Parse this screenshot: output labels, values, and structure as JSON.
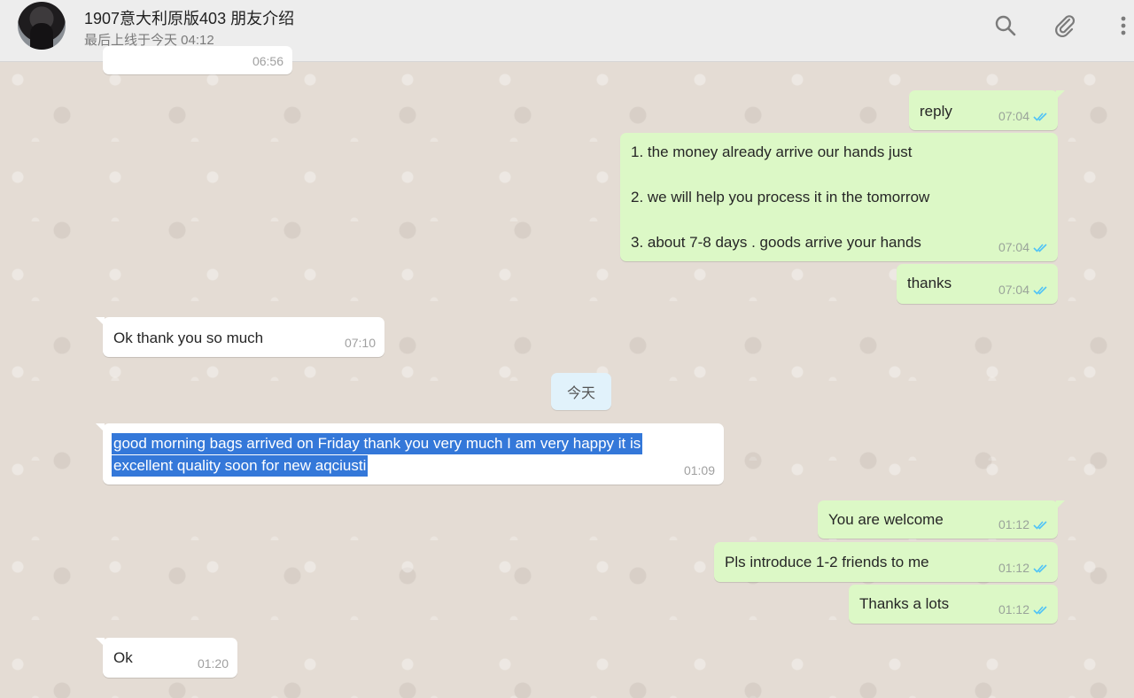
{
  "header": {
    "contact_name": "1907意大利原版403 朋友介绍",
    "contact_status": "最后上线于今天 04:12",
    "icons": [
      "search-icon",
      "attach-icon",
      "menu-icon"
    ]
  },
  "messages": {
    "partial_top": {
      "time": "06:56"
    },
    "m1": {
      "text": "reply",
      "time": "07:04"
    },
    "m2": {
      "line1": "1. the money already arrive our hands just",
      "line2": "2. we will help you process it in the tomorrow",
      "line3": "3. about 7-8 days . goods arrive your hands",
      "time": "07:04"
    },
    "m3": {
      "text": "thanks",
      "time": "07:04"
    },
    "m4": {
      "text": "Ok thank you so much",
      "time": "07:10"
    },
    "date_divider": "今天",
    "m5": {
      "line1": "good morning bags arrived on Friday thank you very much I am very happy it is",
      "line2": "excellent quality soon for new aqciusti",
      "time": "01:09"
    },
    "m6": {
      "text": "You are welcome",
      "time": "01:12"
    },
    "m7": {
      "text": "Pls introduce 1-2 friends to me",
      "time": "01:12"
    },
    "m8": {
      "text": "Thanks a lots",
      "time": "01:12"
    },
    "m9": {
      "text": "Ok",
      "time": "01:20"
    }
  },
  "colors": {
    "outgoing_bubble": "#dcf8c6",
    "incoming_bubble": "#ffffff",
    "read_ticks": "#4fc3f7",
    "selection": "#3478d9",
    "date_chip": "#e1f2fb"
  }
}
